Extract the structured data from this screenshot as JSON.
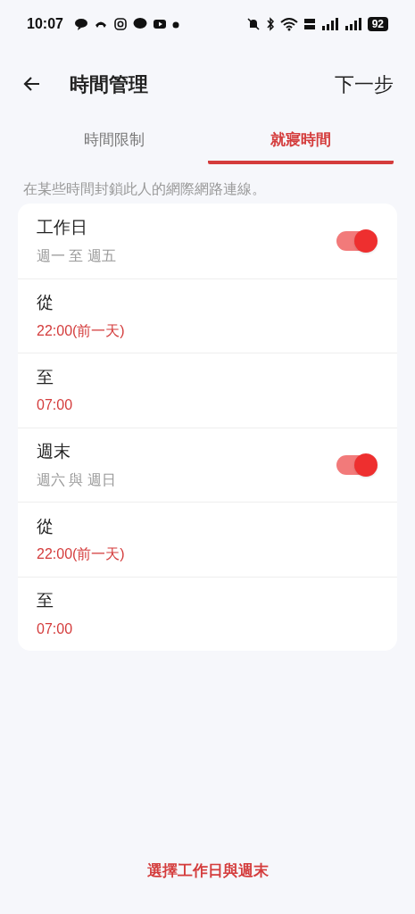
{
  "status_bar": {
    "time": "10:07",
    "battery": "92"
  },
  "header": {
    "title": "時間管理",
    "action": "下一步"
  },
  "tabs": [
    {
      "label": "時間限制",
      "selected": false
    },
    {
      "label": "就寢時間",
      "selected": true
    }
  ],
  "description": "在某些時間封鎖此人的網際網路連線。",
  "rows": [
    {
      "kind": "toggle",
      "label": "工作日",
      "detail": "週一 至 週五",
      "on": true
    },
    {
      "kind": "time",
      "label": "從",
      "detail": "22:00(前一天)"
    },
    {
      "kind": "time",
      "label": "至",
      "detail": "07:00"
    },
    {
      "kind": "toggle",
      "label": "週末",
      "detail": "週六 與 週日",
      "on": true
    },
    {
      "kind": "time",
      "label": "從",
      "detail": "22:00(前一天)"
    },
    {
      "kind": "time",
      "label": "至",
      "detail": "07:00"
    }
  ],
  "footer_button": "選擇工作日與週末"
}
